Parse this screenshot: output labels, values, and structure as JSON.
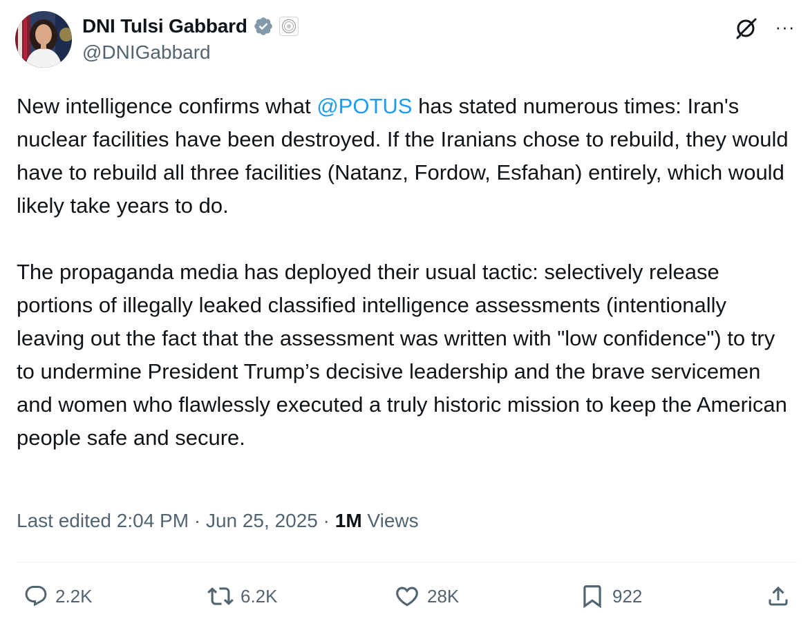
{
  "author": {
    "display_name": "DNI Tulsi Gabbard",
    "handle": "@DNIGabbard",
    "verified": true,
    "avatar_icon": "profile-photo",
    "affiliation_icon": "government-seal-icon"
  },
  "header": {
    "grok_icon": "grok-icon",
    "more_icon": "more-icon",
    "more_glyph": "···"
  },
  "tweet": {
    "paragraph1": {
      "before": "New intelligence confirms what ",
      "mention": "@POTUS",
      "after": " has stated numerous times: Iran's nuclear facilities have been destroyed. If the Iranians chose to rebuild, they would have to rebuild all three facilities (Natanz, Fordow, Esfahan) entirely, which would likely take years to do."
    },
    "paragraph2": "The propaganda media has deployed their usual tactic: selectively release portions of illegally leaked classified intelligence assessments (intentionally leaving out the fact that the assessment was written with \"low confidence\") to try to undermine President Trump’s decisive leadership and the brave servicemen and women who flawlessly executed a truly historic mission to keep the American people safe and secure."
  },
  "meta": {
    "edited_label": "Last edited 2:04 PM",
    "separator": " · ",
    "date": "Jun 25, 2025",
    "views_count": "1M",
    "views_label": " Views"
  },
  "actions": {
    "reply": {
      "icon": "reply-icon",
      "count": "2.2K"
    },
    "repost": {
      "icon": "repost-icon",
      "count": "6.2K"
    },
    "like": {
      "icon": "heart-icon",
      "count": "28K"
    },
    "bookmark": {
      "icon": "bookmark-icon",
      "count": "922"
    },
    "share": {
      "icon": "share-icon"
    }
  },
  "colors": {
    "text": "#0f1419",
    "secondary": "#536471",
    "link": "#1d9bf0",
    "verified": "#829aab"
  }
}
